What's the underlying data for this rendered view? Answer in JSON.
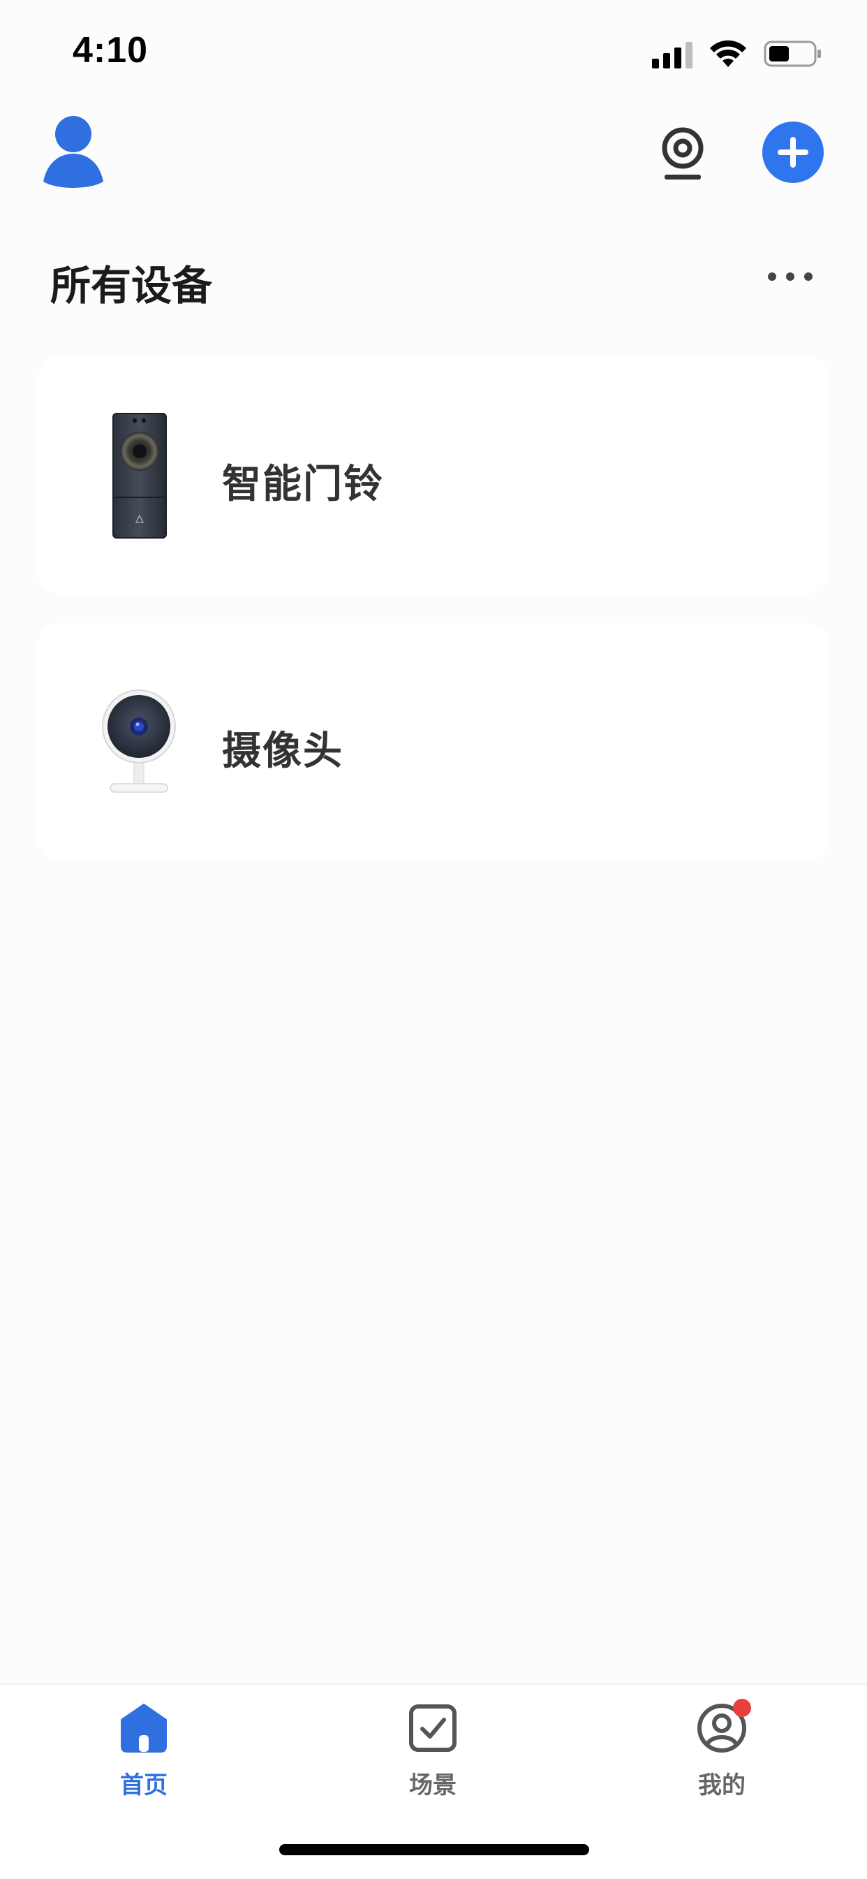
{
  "status_bar": {
    "time": "4:10",
    "icons": [
      "cellular-signal-icon",
      "wifi-icon",
      "battery-icon"
    ]
  },
  "header": {
    "icons": [
      "user-avatar-icon",
      "camera-icon",
      "plus-icon"
    ],
    "accent_color": "#2f75ee"
  },
  "section": {
    "title": "所有设备",
    "more_icon": "ellipsis-icon"
  },
  "devices": [
    {
      "name": "智能门铃",
      "icon": "doorbell-device-icon"
    },
    {
      "name": "摄像头",
      "icon": "camera-device-icon"
    }
  ],
  "tab_bar": {
    "items": [
      {
        "label": "首页",
        "icon": "home-icon",
        "active": true
      },
      {
        "label": "场景",
        "icon": "checkbox-icon",
        "active": false
      },
      {
        "label": "我的",
        "icon": "profile-icon",
        "active": false,
        "has_notification": true
      }
    ],
    "active_color": "#2f6fe0",
    "inactive_color": "#666666",
    "notification_color": "#ea3d3d"
  }
}
